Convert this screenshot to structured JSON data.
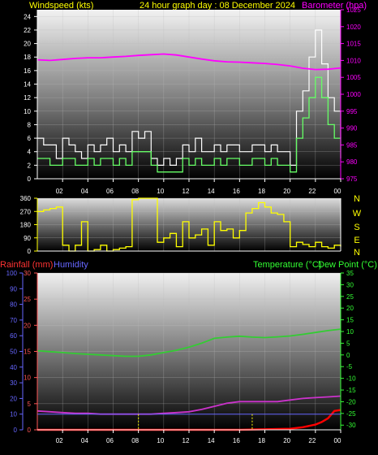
{
  "header": {
    "windspeed_label": "Windspeed (kts)",
    "title": "24 hour graph day : 08 December 2024",
    "barometer_label": "Barometer (hpa)"
  },
  "lower_header": {
    "rainfall_label": "Rainfall (mm)",
    "humidity_label": "Humidity",
    "temperature_label": "Temperature (°C)",
    "dewpoint_label": "Dew Point (°C)"
  },
  "colors": {
    "wind_gust": "#ffffff",
    "wind_avg": "#66ff66",
    "barometer": "#ff00ff",
    "direction": "#ffff00",
    "rainfall": "#ff0000",
    "humidity": "#cc33cc",
    "temperature": "#33cc33",
    "dewpoint": "#cc00ff",
    "rain_axis": "#ff5555",
    "humidity_axis": "#6666ff",
    "temp_axis": "#33ff33",
    "label_green": "#33ff33"
  },
  "chart_data": [
    {
      "type": "line",
      "name": "wind-barometer",
      "x_ticks": [
        "02",
        "04",
        "06",
        "08",
        "10",
        "12",
        "14",
        "16",
        "18",
        "20",
        "22",
        "00"
      ],
      "x_hours": [
        2,
        4,
        6,
        8,
        10,
        12,
        14,
        16,
        18,
        20,
        22,
        24
      ],
      "y_left_ticks": [
        0,
        2,
        4,
        6,
        8,
        10,
        12,
        14,
        16,
        18,
        20,
        22,
        24
      ],
      "y_left_range": [
        0,
        25
      ],
      "y_right_ticks": [
        975,
        980,
        985,
        990,
        995,
        1000,
        1005,
        1010,
        1015,
        1020,
        1025
      ],
      "y_right_range": [
        975,
        1025
      ],
      "series": [
        {
          "name": "Windspeed gust",
          "axis": "left",
          "x": [
            0,
            0.5,
            1,
            1.5,
            2,
            2.5,
            3,
            3.5,
            4,
            4.5,
            5,
            5.5,
            6,
            6.5,
            7,
            7.5,
            8,
            8.5,
            9,
            9.5,
            10,
            10.5,
            11,
            11.5,
            12,
            12.5,
            13,
            13.5,
            14,
            14.5,
            15,
            15.5,
            16,
            16.5,
            17,
            17.5,
            18,
            18.5,
            19,
            19.5,
            20,
            20.5,
            21,
            21.5,
            22,
            22.5,
            23,
            23.5,
            24
          ],
          "values": [
            6,
            5,
            5,
            3,
            6,
            5,
            4,
            3,
            5,
            4,
            5,
            6,
            4,
            5,
            4,
            7,
            6,
            7,
            3,
            2,
            3,
            2,
            3,
            5,
            4,
            6,
            4,
            4,
            5,
            4,
            5,
            5,
            4,
            4,
            5,
            5,
            4,
            5,
            4,
            4,
            2,
            10,
            13,
            18,
            22,
            17,
            12,
            10,
            6
          ]
        },
        {
          "name": "Windspeed average",
          "axis": "left",
          "x": [
            0,
            0.5,
            1,
            1.5,
            2,
            2.5,
            3,
            3.5,
            4,
            4.5,
            5,
            5.5,
            6,
            6.5,
            7,
            7.5,
            8,
            8.5,
            9,
            9.5,
            10,
            10.5,
            11,
            11.5,
            12,
            12.5,
            13,
            13.5,
            14,
            14.5,
            15,
            15.5,
            16,
            16.5,
            17,
            17.5,
            18,
            18.5,
            19,
            19.5,
            20,
            20.5,
            21,
            21.5,
            22,
            22.5,
            23,
            23.5,
            24
          ],
          "values": [
            3,
            3,
            2,
            2,
            3,
            3,
            2,
            2,
            3,
            2,
            3,
            3,
            2,
            3,
            2,
            4,
            4,
            4,
            2,
            1,
            1,
            1,
            1,
            3,
            2,
            3,
            2,
            2,
            3,
            2,
            3,
            3,
            2,
            2,
            3,
            3,
            2,
            3,
            2,
            2,
            1,
            6,
            9,
            12,
            15,
            12,
            8,
            6,
            3
          ]
        },
        {
          "name": "Barometer",
          "axis": "right",
          "x": [
            0,
            1,
            2,
            3,
            4,
            5,
            6,
            7,
            8,
            9,
            10,
            11,
            12,
            13,
            14,
            15,
            16,
            17,
            18,
            19,
            20,
            21,
            22,
            23,
            24
          ],
          "values": [
            1010.2,
            1010,
            1010.3,
            1010.6,
            1010.8,
            1010.8,
            1011,
            1011.2,
            1011.5,
            1011.7,
            1011.9,
            1011.6,
            1011,
            1010.4,
            1009.9,
            1009.6,
            1009.5,
            1009.3,
            1009.1,
            1008.8,
            1008.4,
            1007.7,
            1007.3,
            1007.4,
            1007.8
          ]
        }
      ]
    },
    {
      "type": "line",
      "name": "wind-direction",
      "x_hours": [
        2,
        4,
        6,
        8,
        10,
        12,
        14,
        16,
        18,
        20,
        22,
        24
      ],
      "y_ticks": [
        0,
        90,
        180,
        270,
        360
      ],
      "y_range": [
        0,
        360
      ],
      "compass_labels": [
        "N",
        "W",
        "S",
        "E",
        "N"
      ],
      "series": [
        {
          "name": "Wind direction",
          "x": [
            0,
            0.5,
            1,
            1.5,
            2,
            2.5,
            3,
            3.5,
            4,
            4.5,
            5,
            5.5,
            6,
            6.5,
            7,
            7.5,
            8,
            8.5,
            9,
            9.5,
            10,
            10.5,
            11,
            11.5,
            12,
            12.5,
            13,
            13.5,
            14,
            14.5,
            15,
            15.5,
            16,
            16.5,
            17,
            17.5,
            18,
            18.5,
            19,
            19.5,
            20,
            20.5,
            21,
            21.5,
            22,
            22.5,
            23,
            23.5,
            24
          ],
          "values": [
            270,
            280,
            290,
            300,
            40,
            0,
            40,
            200,
            0,
            10,
            40,
            0,
            10,
            20,
            30,
            350,
            360,
            360,
            360,
            60,
            90,
            120,
            30,
            200,
            90,
            110,
            150,
            40,
            200,
            140,
            150,
            90,
            140,
            260,
            290,
            330,
            300,
            260,
            250,
            200,
            30,
            60,
            45,
            30,
            60,
            30,
            20,
            40,
            30
          ]
        }
      ]
    },
    {
      "type": "line",
      "name": "rain-humidity-temperature",
      "x_ticks": [
        "02",
        "04",
        "06",
        "08",
        "10",
        "12",
        "14",
        "16",
        "18",
        "20",
        "22",
        "00"
      ],
      "x_hours": [
        2,
        4,
        6,
        8,
        10,
        12,
        14,
        16,
        18,
        20,
        22,
        24
      ],
      "y_rain_ticks": [
        0,
        5,
        10,
        15,
        20,
        25,
        30
      ],
      "y_rain_range": [
        0,
        30
      ],
      "y_humidity_ticks": [
        0,
        10,
        20,
        30,
        40,
        50,
        60,
        70,
        80,
        90,
        100
      ],
      "y_humidity_range": [
        0,
        100
      ],
      "y_temp_ticks": [
        -30,
        -25,
        -20,
        -15,
        -10,
        -5,
        0,
        5,
        10,
        15,
        20,
        25,
        30,
        35
      ],
      "y_temp_range": [
        -32,
        35
      ],
      "series": [
        {
          "name": "Temperature",
          "axis": "temp",
          "x": [
            0,
            1,
            2,
            3,
            4,
            5,
            6,
            7,
            8,
            9,
            10,
            11,
            12,
            13,
            14,
            15,
            16,
            17,
            18,
            19,
            20,
            21,
            22,
            23,
            24
          ],
          "values": [
            1.8,
            1.4,
            1.0,
            0.6,
            0.3,
            0.0,
            -0.3,
            -0.6,
            -0.6,
            0.0,
            1.0,
            2.0,
            3.3,
            5.0,
            7.1,
            7.6,
            8.0,
            7.6,
            7.4,
            7.7,
            8.1,
            8.8,
            9.6,
            10.4,
            11.0
          ]
        },
        {
          "name": "Humidity",
          "axis": "humidity",
          "x": [
            0,
            1,
            2,
            3,
            4,
            5,
            6,
            7,
            8,
            9,
            10,
            11,
            12,
            13,
            14,
            15,
            16,
            17,
            18,
            19,
            20,
            21,
            22,
            23,
            24
          ],
          "values": [
            12,
            11.5,
            11,
            10.5,
            10.5,
            10,
            10,
            10,
            10,
            10,
            10.5,
            11,
            11.5,
            13,
            15,
            17,
            18,
            18,
            18,
            18,
            19,
            20,
            20.5,
            21,
            21.5
          ]
        },
        {
          "name": "Rainfall",
          "axis": "rain",
          "x": [
            0,
            8,
            16,
            20,
            21,
            22,
            22.5,
            23,
            23.5,
            24
          ],
          "values": [
            0,
            0,
            0,
            0.2,
            0.5,
            1,
            1.5,
            2.2,
            3.6,
            3.8
          ]
        }
      ]
    }
  ]
}
